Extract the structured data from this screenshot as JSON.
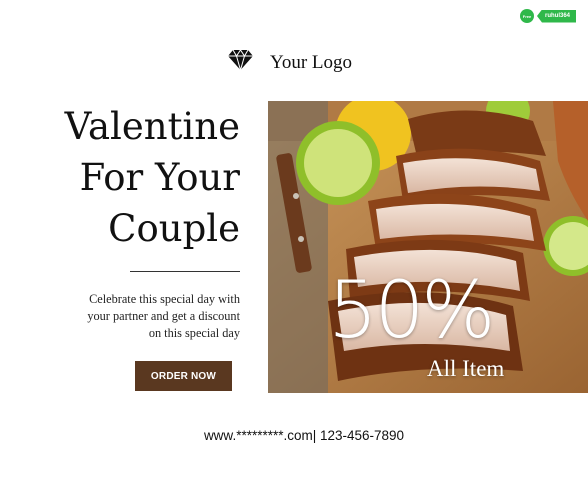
{
  "badge": {
    "circle_text": "Free",
    "tag_text": "ruhul364"
  },
  "logo": {
    "icon": "diamond-icon",
    "text": "Your Logo"
  },
  "headline": {
    "line1": "Valentine",
    "line2": "For Your",
    "line3": "Couple"
  },
  "description": {
    "line1": "Celebrate this special day with",
    "line2": "your partner and get a discount",
    "line3": "on this special day"
  },
  "cta": {
    "label": "ORDER NOW"
  },
  "promo": {
    "discount": "50%",
    "subtitle": "All Item"
  },
  "footer": {
    "contact": "www.*********.com| 123-456-7890"
  },
  "colors": {
    "button": "#5a3820",
    "badge": "#2fb84a",
    "text": "#111111"
  }
}
